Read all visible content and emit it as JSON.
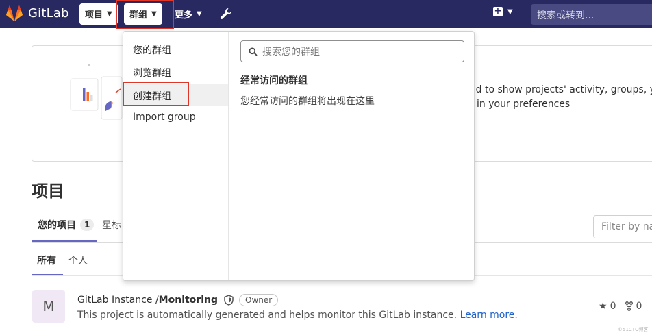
{
  "navbar": {
    "brand": "GitLab",
    "projects_label": "项目",
    "groups_label": "群组",
    "more_label": "更多",
    "search_placeholder": "搜索或转到..."
  },
  "welcome": {
    "line1": "ed to show projects' activity, groups, yo",
    "line2": "in your preferences"
  },
  "page": {
    "title": "项目",
    "tab_your_projects": "您的项目",
    "tab_your_projects_count": "1",
    "tab_starred": "星标",
    "filter_placeholder": "Filter by na",
    "subtab_all": "所有",
    "subtab_personal": "个人"
  },
  "project": {
    "avatar_letter": "M",
    "namespace": "GitLab Instance / ",
    "name": "Monitoring",
    "role_badge": "Owner",
    "description": "This project is automatically generated and helps monitor this GitLab instance.",
    "learn_more": "Learn more.",
    "stars": "0",
    "forks": "0"
  },
  "groups_dropdown": {
    "items": [
      {
        "label": "您的群组"
      },
      {
        "label": "浏览群组"
      },
      {
        "label": "创建群组"
      },
      {
        "label": "Import group"
      }
    ],
    "search_placeholder": "搜索您的群组",
    "frequent_title": "经常访问的群组",
    "frequent_empty": "您经常访问的群组将出现在这里"
  },
  "watermark": "©51CTO博客",
  "colors": {
    "navbar_bg": "#292961",
    "highlight_box": "#e0362a",
    "tab_underline": "#6666c4",
    "link": "#1f62c9"
  }
}
